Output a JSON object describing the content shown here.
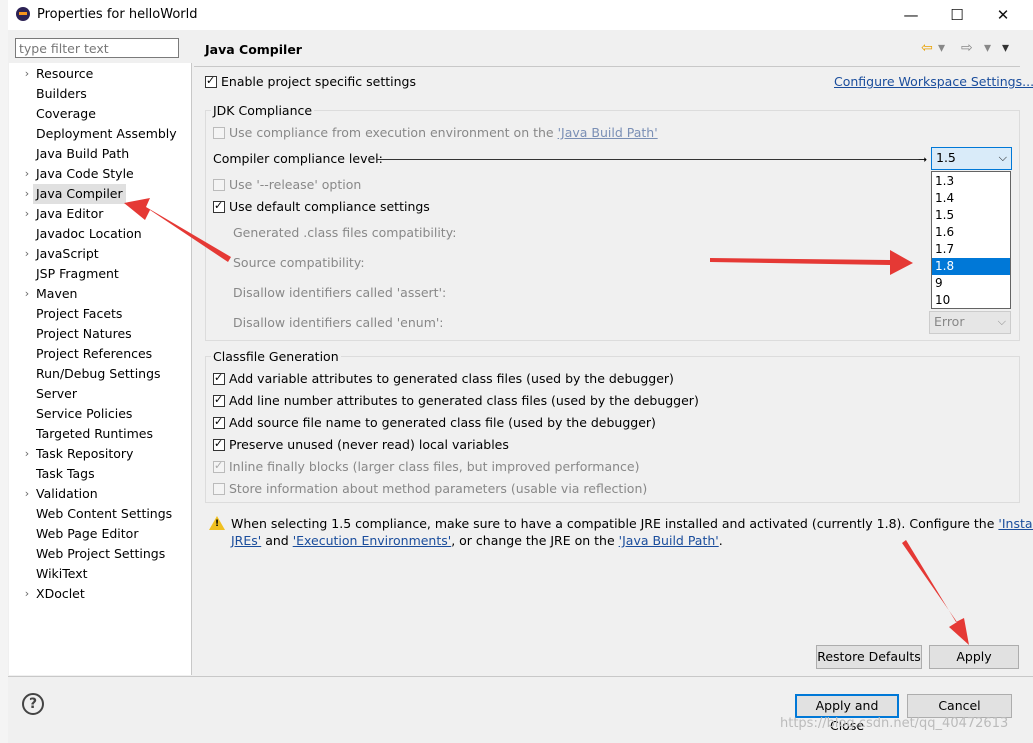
{
  "window": {
    "title": "Properties for helloWorld",
    "minimize": "—",
    "maximize": "☐",
    "close": "✕"
  },
  "filter": {
    "placeholder": "type filter text"
  },
  "tree": [
    {
      "label": "Resource",
      "expandable": true
    },
    {
      "label": "Builders",
      "expandable": false
    },
    {
      "label": "Coverage",
      "expandable": false
    },
    {
      "label": "Deployment Assembly",
      "expandable": false
    },
    {
      "label": "Java Build Path",
      "expandable": false
    },
    {
      "label": "Java Code Style",
      "expandable": true
    },
    {
      "label": "Java Compiler",
      "expandable": true,
      "selected": true
    },
    {
      "label": "Java Editor",
      "expandable": true
    },
    {
      "label": "Javadoc Location",
      "expandable": false
    },
    {
      "label": "JavaScript",
      "expandable": true
    },
    {
      "label": "JSP Fragment",
      "expandable": false
    },
    {
      "label": "Maven",
      "expandable": true
    },
    {
      "label": "Project Facets",
      "expandable": false
    },
    {
      "label": "Project Natures",
      "expandable": false
    },
    {
      "label": "Project References",
      "expandable": false
    },
    {
      "label": "Run/Debug Settings",
      "expandable": false
    },
    {
      "label": "Server",
      "expandable": false
    },
    {
      "label": "Service Policies",
      "expandable": false
    },
    {
      "label": "Targeted Runtimes",
      "expandable": false
    },
    {
      "label": "Task Repository",
      "expandable": true
    },
    {
      "label": "Task Tags",
      "expandable": false
    },
    {
      "label": "Validation",
      "expandable": true
    },
    {
      "label": "Web Content Settings",
      "expandable": false
    },
    {
      "label": "Web Page Editor",
      "expandable": false
    },
    {
      "label": "Web Project Settings",
      "expandable": false
    },
    {
      "label": "WikiText",
      "expandable": false
    },
    {
      "label": "XDoclet",
      "expandable": true
    }
  ],
  "page": {
    "title": "Java Compiler",
    "enable_specific": "Enable project specific settings",
    "configure_workspace": "Configure Workspace Settings...",
    "jdk_group": "JDK Compliance",
    "use_compliance_prefix": "Use compliance from execution environment on the ",
    "use_compliance_link": "'Java Build Path'",
    "compliance_level_label": "Compiler compliance level:",
    "compliance_level_value": "1.5",
    "use_release": "Use '--release' option",
    "use_default": "Use default compliance settings",
    "generated_class": "Generated .class files compatibility:",
    "source_compat": "Source compatibility:",
    "disallow_assert": "Disallow identifiers called 'assert':",
    "disallow_enum": "Disallow identifiers called 'enum':",
    "enum_value": "Error",
    "dropdown_options": [
      "1.3",
      "1.4",
      "1.5",
      "1.6",
      "1.7",
      "1.8",
      "9",
      "10"
    ],
    "dropdown_selected": "1.8",
    "classfile_group": "Classfile Generation",
    "cf_opt1": "Add variable attributes to generated class files (used by the debugger)",
    "cf_opt2": "Add line number attributes to generated class files (used by the debugger)",
    "cf_opt3": "Add source file name to generated class file (used by the debugger)",
    "cf_opt4": "Preserve unused (never read) local variables",
    "cf_opt5": "Inline finally blocks (larger class files, but improved performance)",
    "cf_opt6": "Store information about method parameters (usable via reflection)",
    "warn_text1": "When selecting 1.5 compliance, make sure to have a compatible JRE installed and activated (currently 1.8). Configure the ",
    "warn_link1a": "'Installed",
    "warn_link1b": "JREs'",
    "warn_and": " and ",
    "warn_link2": "'Execution Environments'",
    "warn_text2": ", or change the JRE on the ",
    "warn_link3": "'Java Build Path'",
    "warn_end": ".",
    "restore_defaults": "Restore Defaults",
    "apply": "Apply"
  },
  "footer": {
    "help": "?",
    "apply_close": "Apply and Close",
    "cancel": "Cancel"
  },
  "watermark": "https://blog.csdn.net/qq_40472613",
  "colors": {
    "accent": "#0078d7",
    "link": "#1a4d9c",
    "arrow": "#e53935"
  }
}
